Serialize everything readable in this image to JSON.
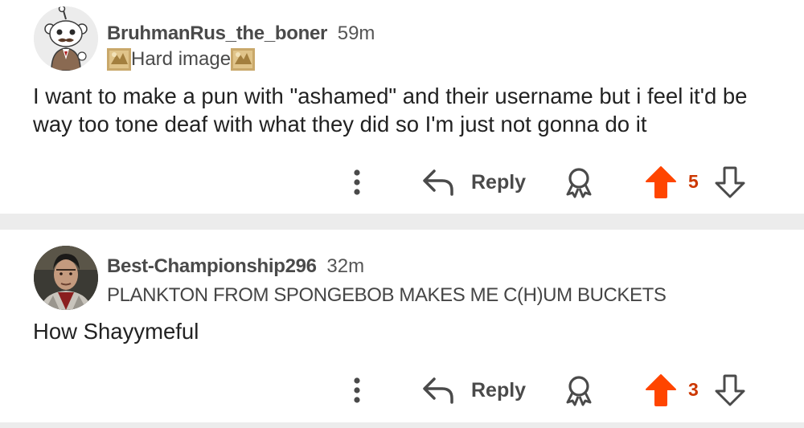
{
  "colors": {
    "upvote_active": "#ff4500",
    "score_active": "#cc3700",
    "icon_gray": "#555555",
    "divider": "#ececec"
  },
  "comments": [
    {
      "username": "BruhmanRus_the_boner",
      "time": "59m",
      "flair": "Hard image",
      "flair_icons": [
        "flair-emoji-icon",
        "flair-emoji-icon"
      ],
      "body": "I want to make a pun with \"ashamed\" and their username but i feel it'd be way too tone deaf with what they did so I'm just not gonna do it",
      "reply_label": "Reply",
      "score": "5",
      "upvoted": true,
      "avatar_icon": "snoo-avatar-icon"
    },
    {
      "username": "Best-Championship296",
      "time": "32m",
      "flair": "PLANKTON FROM SPONGEBOB MAKES ME C(H)UM BUCKETS",
      "flair_icons": [],
      "body": "How Shayymeful",
      "reply_label": "Reply",
      "score": "3",
      "upvoted": true,
      "avatar_icon": "profile-photo-avatar"
    }
  ],
  "icons": {
    "more": "more-options-icon",
    "reply": "reply-arrow-icon",
    "award": "award-icon",
    "upvote": "upvote-arrow-icon",
    "downvote": "downvote-arrow-icon"
  }
}
